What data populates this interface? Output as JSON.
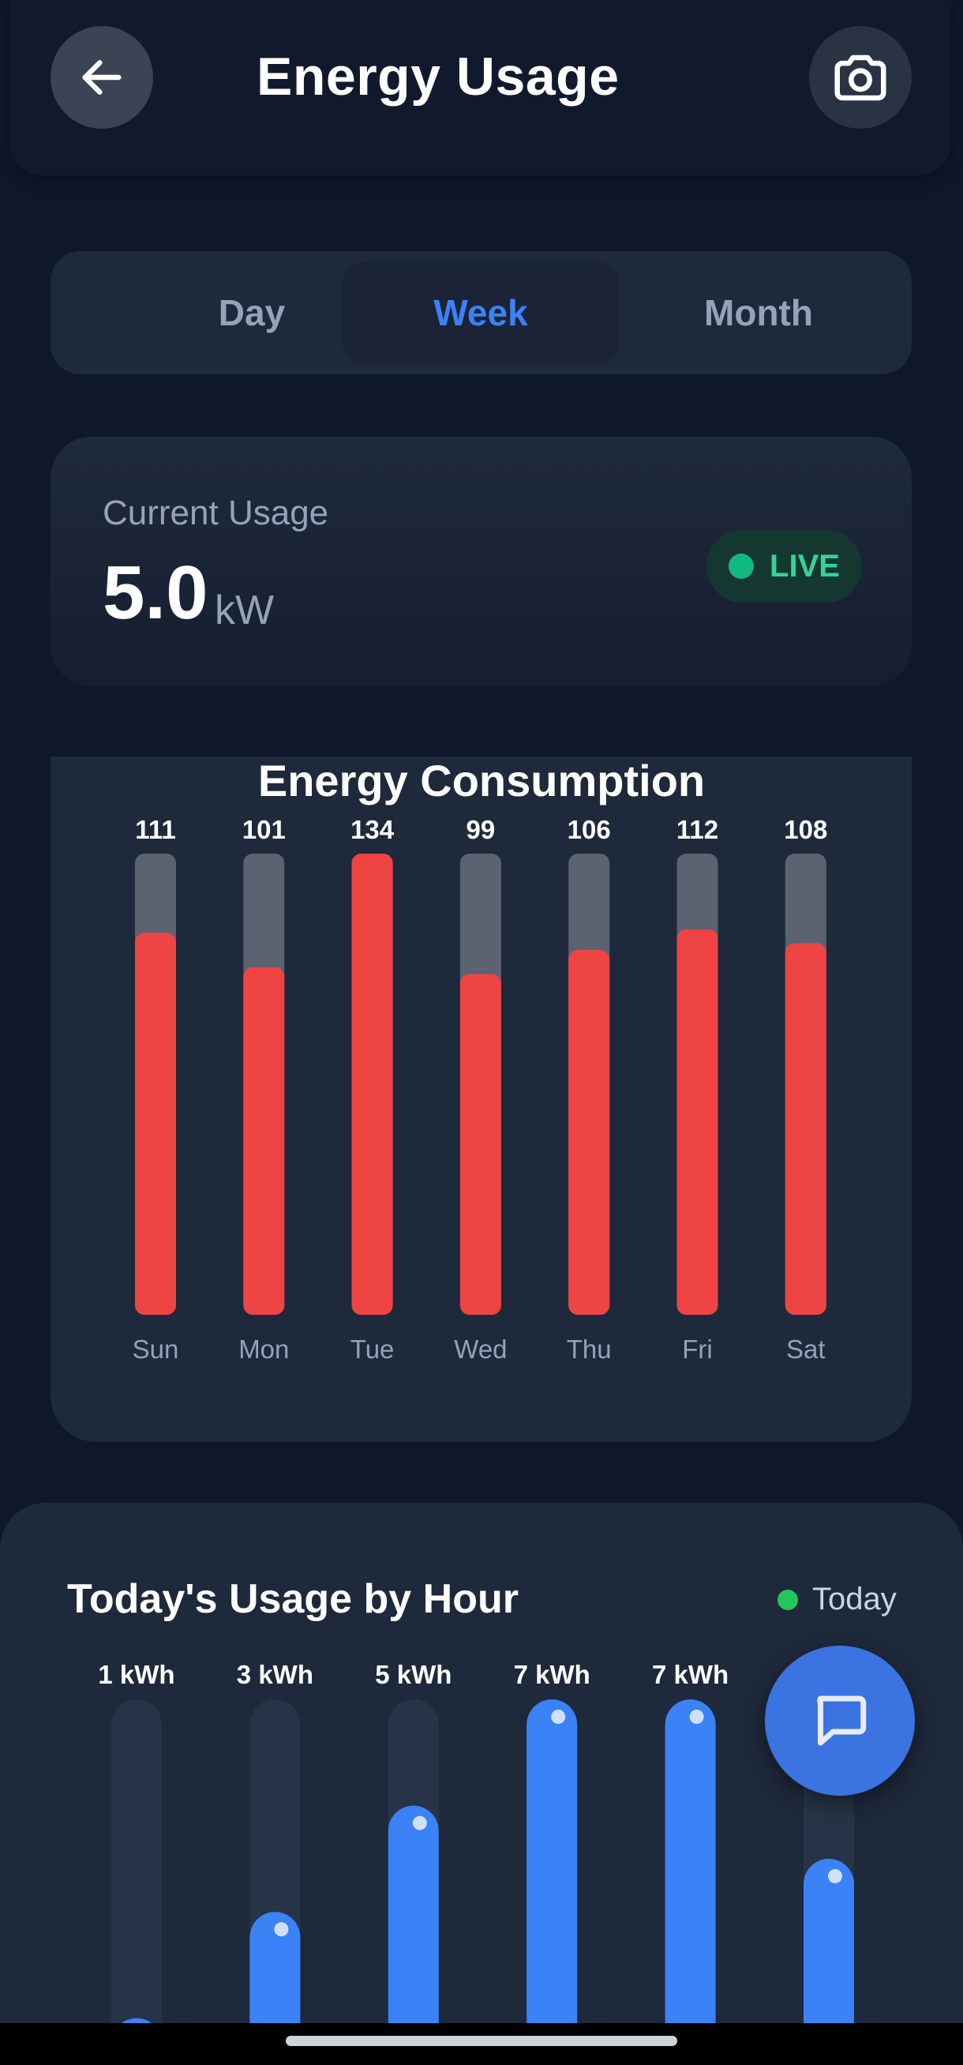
{
  "header": {
    "title": "Energy Usage",
    "back_icon": "arrow-left-icon",
    "camera_icon": "camera-icon"
  },
  "tabs": [
    {
      "label": "Day",
      "active": false
    },
    {
      "label": "Week",
      "active": true
    },
    {
      "label": "Month",
      "active": false
    }
  ],
  "current_usage": {
    "label": "Current Usage",
    "value": "5.0",
    "unit": "kW",
    "badge": "LIVE"
  },
  "hourly": {
    "title": "Today's Usage by Hour",
    "legend_label": "Today"
  },
  "colors": {
    "background": "#0f172a",
    "card": "#1e293b",
    "accent_blue": "#3b82f6",
    "bar_red": "#ef4444",
    "bar_track": "#5b6270",
    "live_green": "#10b981"
  },
  "chart_data": [
    {
      "type": "bar",
      "title": "Energy Consumption",
      "categories": [
        "Sun",
        "Mon",
        "Tue",
        "Wed",
        "Thu",
        "Fri",
        "Sat"
      ],
      "values": [
        111,
        101,
        134,
        99,
        106,
        112,
        108
      ],
      "value_labels": [
        "111",
        "101",
        "134",
        "99",
        "106",
        "112",
        "108"
      ],
      "ylim": [
        0,
        134
      ]
    },
    {
      "type": "bar",
      "title": "Today's Usage by Hour",
      "values": [
        1,
        3,
        5,
        7,
        7,
        4
      ],
      "value_labels": [
        "1 kWh",
        "3 kWh",
        "5 kWh",
        "7 kWh",
        "7 kWh",
        "4 kWh"
      ],
      "ylim": [
        0,
        7
      ]
    }
  ]
}
